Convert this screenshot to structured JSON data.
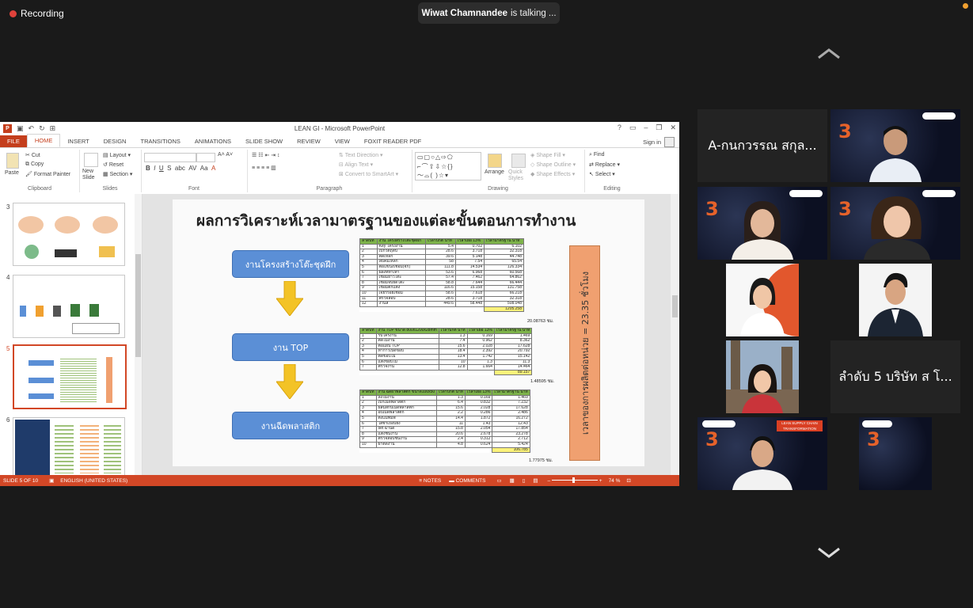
{
  "meeting": {
    "recording_label": "Recording",
    "speaker_name": "Wiwat  Chamnandee",
    "speaker_status": "is talking ..."
  },
  "ppt": {
    "window_title": "LEAN GI - Microsoft PowerPoint",
    "tabs": [
      "FILE",
      "HOME",
      "INSERT",
      "DESIGN",
      "TRANSITIONS",
      "ANIMATIONS",
      "SLIDE SHOW",
      "REVIEW",
      "VIEW",
      "FOXIT READER PDF"
    ],
    "sign_in": "Sign in",
    "ribbon": {
      "paste": "Paste",
      "cut": "Cut",
      "copy": "Copy",
      "format_painter": "Format Painter",
      "clipboard": "Clipboard",
      "new_slide": "New Slide",
      "layout": "Layout",
      "reset": "Reset",
      "section": "Section",
      "slides": "Slides",
      "font": "Font",
      "text_direction": "Text Direction",
      "align_text": "Align Text",
      "convert_smartart": "Convert to SmartArt",
      "paragraph": "Paragraph",
      "arrange": "Arrange",
      "quick_styles": "Quick Styles",
      "shape_fill": "Shape Fill",
      "shape_outline": "Shape Outline",
      "shape_effects": "Shape Effects",
      "drawing": "Drawing",
      "find": "Find",
      "replace": "Replace",
      "select": "Select",
      "editing": "Editing"
    },
    "thumbnails": [
      "3",
      "4",
      "5",
      "6"
    ],
    "slide": {
      "title": "ผลการวิเคราะห์เวลามาตรฐานของแต่ละขั้นตอนการทำงาน",
      "flow": [
        "งานโครงสร้างโต๊ะชุดฝึก",
        "งาน TOP",
        "งานฉีดพลาสติก"
      ],
      "vertical_text": "เวลาของการผลิตต่อหน่วย = 23.35 ชั่วโมง",
      "table1": {
        "header": [
          "ลำดับที่",
          "งาน โครงสร้างโต๊ะชุดฝึก",
          "เวลาปกติ นาที",
          "เวลาเผื่อ 13%",
          "เวลามาตรฐาน นาที"
        ],
        "rows": [
          [
            "1",
            "Key โครงงาน",
            "5.4",
            "0.702",
            "6.102"
          ],
          [
            "2",
            "เบิกวัตถุดิบ",
            "28.6",
            "3.718",
            "32.318"
          ],
          [
            "3",
            "ตัดเหล็ก",
            "39.6",
            "5.148",
            "44.748"
          ],
          [
            "4",
            "ลบคมเหล็ก",
            "58",
            "7.54",
            "65.54"
          ],
          [
            "5",
            "ต่อแขนงเชื่อม(จิ๊ก)",
            "111.8",
            "14.534",
            "126.334"
          ],
          [
            "6",
            "ผลงที่ทำเท่า",
            "53.6",
            "6.968",
            "60.568"
          ],
          [
            "7",
            "เชื่อมยาวโต๊ะ",
            "57.4",
            "7.462",
            "64.862"
          ],
          [
            "8",
            "เชื่อมจับยึดโต๊ะ",
            "58.8",
            "7.644",
            "66.444"
          ],
          [
            "9",
            "เชื่อมตกแต่ง",
            "116.6",
            "15.158",
            "131.758"
          ],
          [
            "10",
            "เจียรรอยเชื่อม",
            "58.6",
            "7.618",
            "66.218"
          ],
          [
            "11",
            "ตรวจสอบ",
            "28.6",
            "3.718",
            "32.318"
          ],
          [
            "12",
            "งานสี",
            "449.6",
            "58.448",
            "508.048"
          ]
        ],
        "total": "1205.258",
        "note": "20.08763 ชม."
      },
      "table2": {
        "header": [
          "ลำดับที่",
          "งาน TOP ขนาด 800x1200x28mm",
          "เวลาปกติ นาที",
          "เวลาเผื่อ 13%",
          "เวลามาตรฐาน นาที"
        ],
        "rows": [
          [
            "1",
            "รับโครงาน",
            "1.3",
            "0.169",
            "1.469"
          ],
          [
            "2",
            "ตัดไม้งาน",
            "7.4",
            "0.962",
            "8.362"
          ],
          [
            "3",
            "ตอแผน TOP",
            "15.6",
            "2.028",
            "17.628"
          ],
          [
            "4",
            "ทากาวเปิดขอบ",
            "18.4",
            "2.392",
            "20.792"
          ],
          [
            "5",
            "ตัดขอบไม้",
            "13.4",
            "1.742",
            "15.142"
          ],
          [
            "6",
            "แต่งขอบไม้",
            "10",
            "1.3",
            "11.3"
          ],
          [
            "7",
            "ตรวจงาน",
            "12.8",
            "1.664",
            "14.464"
          ]
        ],
        "total": "89.157",
        "note": "1.48595 ชม."
      },
      "table3": {
        "header": [
          "ลำดับที่",
          "งาน ฉีดฝาพลาสติก ขนาด100x50",
          "เวลาปกติ นาที",
          "เวลาเผื่อ 13%",
          "เวลามาตรฐาน นาที"
        ],
        "rows": [
          [
            "1",
            "ลงโมงาน",
            "1.3",
            "0.169",
            "1.469"
          ],
          [
            "2",
            "เบิกเม็ดพลาสติก",
            "6.4",
            "0.832",
            "7.232"
          ],
          [
            "3",
            "ผสมสีกับเม็ดพลาสติก",
            "15.6",
            "2.028",
            "17.628"
          ],
          [
            "4",
            "อบเม็ดพลาสติก",
            "2.2",
            "0.286",
            "2.486"
          ],
          [
            "5",
            "ตั้งแม่พิมพ์",
            "14.4",
            "1.872",
            "16.272"
          ],
          [
            "6",
            "ใส่ชำเถอบยิง",
            "11",
            "1.43",
            "12.43"
          ],
          [
            "7",
            "set ฉาน็ด",
            "15.8",
            "2.054",
            "17.854"
          ],
          [
            "8",
            "แต่งชิ้นงาน",
            "20.6",
            "2.678",
            "23.278"
          ],
          [
            "9",
            "ตรวจสอบชิ้นงาน",
            "2.4",
            "0.312",
            "2.712"
          ],
          [
            "10",
            "ฝาตัดงาน",
            "4.8",
            "0.624",
            "5.424"
          ]
        ],
        "total": "106.785",
        "note": "1.77975 ชม."
      }
    },
    "status": {
      "slide_of": "SLIDE 5 OF 10",
      "language": "ENGLISH (UNITED STATES)",
      "notes": "NOTES",
      "comments": "COMMENTS",
      "zoom": "74 %"
    }
  },
  "participants": {
    "name_tile_1": "A-กนกวรรณ สกุล...",
    "name_tile_2": "ลำดับ 5 บริษัท ส โ...",
    "badge_text": "LEAN SUPPLY CHAIN TRANSFORMATION"
  },
  "colors": {
    "accent": "#d24726",
    "flow_box": "#5b8fd6",
    "arrow": "#f3c326",
    "table_header": "#7db34a"
  }
}
